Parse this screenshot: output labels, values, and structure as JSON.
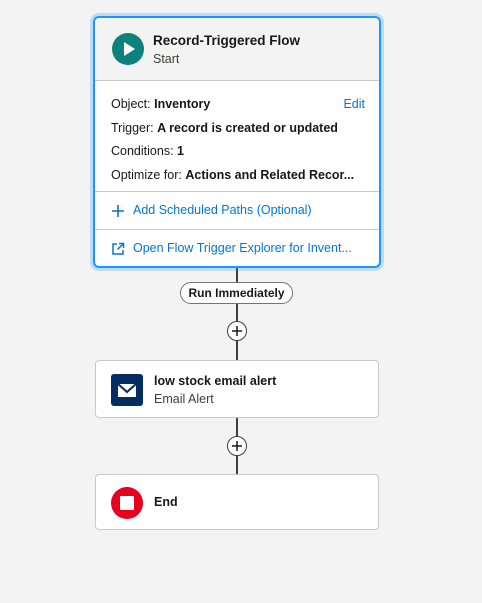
{
  "start": {
    "title": "Record-Triggered Flow",
    "subtitle": "Start",
    "edit_label": "Edit",
    "object_label": "Object:",
    "object_value": "Inventory",
    "trigger_label": "Trigger:",
    "trigger_value": "A record is created or updated",
    "conditions_label": "Conditions:",
    "conditions_value": "1",
    "optimize_label": "Optimize for:",
    "optimize_value": "Actions and Related Recor...",
    "add_paths_label": "Add Scheduled Paths (Optional)",
    "explorer_label": "Open Flow Trigger Explorer for Invent...",
    "icon": "play-icon",
    "icon_color": "#0b827c",
    "accent": "#1b96ff"
  },
  "path_label": "Run Immediately",
  "elements": [
    {
      "title": "low stock email alert",
      "subtitle": "Email Alert",
      "icon": "envelope-icon",
      "icon_color": "#032d60"
    }
  ],
  "end": {
    "title": "End",
    "icon": "stop-icon",
    "icon_color": "#ea001e"
  },
  "link_color": "#0176d3"
}
